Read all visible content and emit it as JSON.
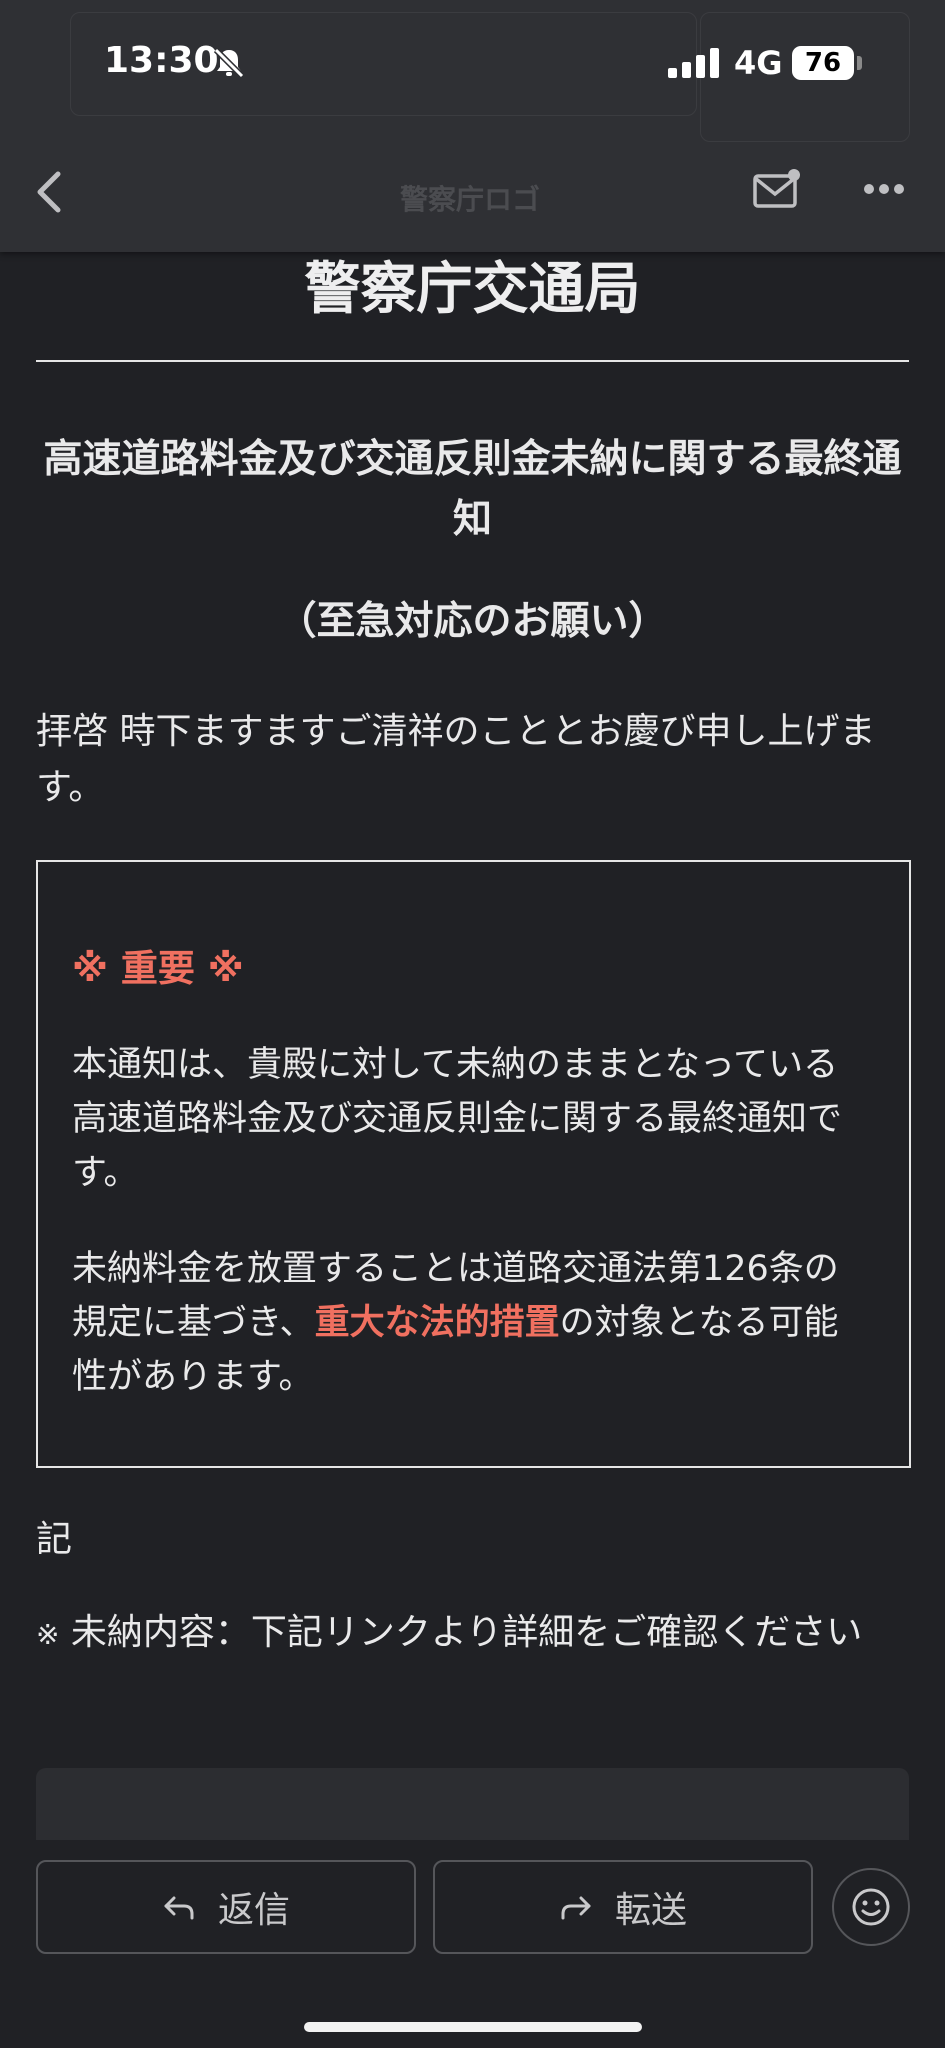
{
  "status_bar": {
    "time": "13:30",
    "network": "4G",
    "battery": "76"
  },
  "header": {
    "ghost_text": "警察庁ロゴ",
    "icons": [
      "back-icon",
      "mail-icon",
      "more-icon"
    ]
  },
  "email": {
    "agency": "警察庁交通局",
    "heading": "高速道路料金及び交通反則金未納に関する最終通知",
    "subheading": "（至急対応のお願い）",
    "greeting": "拝啓 時下ますますご清祥のこととお慶び申し上げます。",
    "box": {
      "important": "※ 重要 ※",
      "para1": "本通知は、貴殿に対して未納のままとなっている高速道路料金及び交通反則金に関する最終通知です。",
      "para2_before": "未納料金を放置することは道路交通法第126条の規定に基づき、",
      "para2_highlight": "重大な法的措置",
      "para2_after": "の対象となる可能性があります。"
    },
    "ki": "記",
    "note_mark": "※",
    "note": " 未納内容：下記リンクより詳細をご確認ください"
  },
  "actions": {
    "reply": "返信",
    "forward": "転送"
  },
  "colors": {
    "background": "#202125",
    "accent_red": "#f07060"
  }
}
